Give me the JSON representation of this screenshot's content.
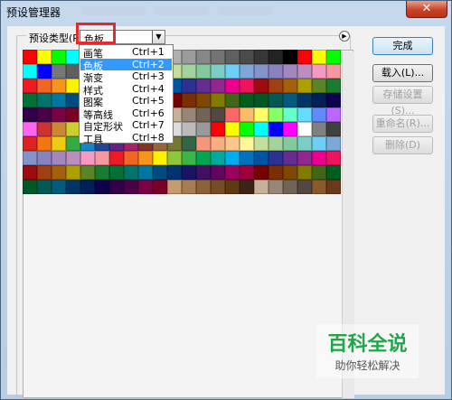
{
  "window": {
    "title": "预设管理器",
    "close_label": "✕"
  },
  "preset_type": {
    "label": "预设类型(P):",
    "value": "色板"
  },
  "menu_items": [
    {
      "label": "画笔",
      "shortcut": "Ctrl+1",
      "selected": false
    },
    {
      "label": "色板",
      "shortcut": "Ctrl+2",
      "selected": true
    },
    {
      "label": "渐变",
      "shortcut": "Ctrl+3",
      "selected": false
    },
    {
      "label": "样式",
      "shortcut": "Ctrl+4",
      "selected": false
    },
    {
      "label": "图案",
      "shortcut": "Ctrl+5",
      "selected": false
    },
    {
      "label": "等高线",
      "shortcut": "Ctrl+6",
      "selected": false
    },
    {
      "label": "自定形状",
      "shortcut": "Ctrl+7",
      "selected": false
    },
    {
      "label": "工具",
      "shortcut": "Ctrl+8",
      "selected": false
    }
  ],
  "buttons": {
    "done": "完成",
    "load": "载入(L)...",
    "save": "存储设置(S)...",
    "rename": "重命名(R)...",
    "delete": "删除(D)"
  },
  "swatches": [
    "#ff0000",
    "#ffff00",
    "#00ff00",
    "#00ffff",
    "#0000ff",
    "#ff00ff",
    "#ffffff",
    "#ebebeb",
    "#d7d7d7",
    "#c3c3c3",
    "#afafaf",
    "#9b9b9b",
    "#878787",
    "#737373",
    "#5f5f5f",
    "#4b4b4b",
    "#373737",
    "#232323",
    "#000000",
    "#ff0000",
    "#ffff00",
    "#00ff00",
    "#00ffff",
    "#0000ff",
    "#777777",
    "#5f5f5f",
    "#454545",
    "#2b2b2b",
    "#f7977a",
    "#f9ad81",
    "#fdc68a",
    "#fff79a",
    "#c4df9b",
    "#a3d39c",
    "#82ca9d",
    "#7bcdc8",
    "#6ecff6",
    "#7ea7d8",
    "#8493ca",
    "#8882be",
    "#a187be",
    "#bc8dbf",
    "#f49ac2",
    "#f6989d",
    "#ed1c24",
    "#f26522",
    "#f7941d",
    "#fff200",
    "#8dc63f",
    "#39b54a",
    "#00a651",
    "#00a99d",
    "#00aeef",
    "#0072bc",
    "#0054a6",
    "#2e3192",
    "#662d91",
    "#92278f",
    "#ec008c",
    "#ed145b",
    "#9e0b0f",
    "#a0410d",
    "#a36209",
    "#aba000",
    "#598527",
    "#1a7b30",
    "#007236",
    "#00746b",
    "#0076a3",
    "#004b80",
    "#003471",
    "#1b1464",
    "#440e62",
    "#630460",
    "#9e005d",
    "#9e0039",
    "#790000",
    "#7b2e00",
    "#7d4900",
    "#827b00",
    "#406618",
    "#005e20",
    "#005826",
    "#005952",
    "#005b7f",
    "#003663",
    "#002157",
    "#0d004c",
    "#32004b",
    "#4b0049",
    "#7b0046",
    "#7a0026",
    "#c69c6d",
    "#a67c52",
    "#8c6239",
    "#754c24",
    "#603913",
    "#3c2415",
    "#c7b299",
    "#998675",
    "#736357",
    "#534741",
    "#ff6666",
    "#ffbb66",
    "#ffff66",
    "#88ff66",
    "#66ffcc",
    "#66ddff",
    "#6688ff",
    "#bb66ff",
    "#ff66ee",
    "#cc3333",
    "#cc8833",
    "#cccc33",
    "#55aa33",
    "#33aa88",
    "#3399cc",
    "#3355cc",
    "#8833cc",
    "#cc33aa",
    "#dddddd",
    "#bbbbbb",
    "#999999",
    "#ff0000",
    "#ffff00",
    "#00ff00",
    "#00ffff",
    "#0000ff",
    "#ff00ff",
    "#ffffff",
    "#808080",
    "#404040",
    "#dd2222",
    "#ee7711",
    "#eecc11",
    "#33aa44",
    "#1188cc",
    "#224499",
    "#662288",
    "#aa2266",
    "#883322",
    "#996633",
    "#777733",
    "#336644",
    "#f7977a",
    "#f9ad81",
    "#fdc68a",
    "#fff79a",
    "#c4df9b",
    "#a3d39c",
    "#82ca9d",
    "#7bcdc8",
    "#6ecff6",
    "#7ea7d8",
    "#8493ca",
    "#8882be",
    "#a187be",
    "#bc8dbf",
    "#f49ac2",
    "#f6989d",
    "#ed1c24",
    "#f26522",
    "#f7941d",
    "#fff200",
    "#8dc63f",
    "#39b54a",
    "#00a651",
    "#00a99d",
    "#00aeef",
    "#0072bc",
    "#0054a6",
    "#2e3192",
    "#662d91",
    "#92278f",
    "#ec008c",
    "#ed145b",
    "#9e0b0f",
    "#a0410d",
    "#a36209",
    "#aba000",
    "#598527",
    "#1a7b30",
    "#007236",
    "#00746b",
    "#0076a3",
    "#004b80",
    "#003471",
    "#1b1464",
    "#440e62",
    "#630460",
    "#9e005d",
    "#9e0039",
    "#790000",
    "#7b2e00",
    "#7d4900",
    "#827b00",
    "#406618",
    "#005e20",
    "#005826",
    "#005952",
    "#005b7f",
    "#003663",
    "#002157",
    "#0d004c",
    "#32004b",
    "#4b0049",
    "#7b0046",
    "#7a0026",
    "#c69c6d",
    "#a67c52",
    "#8c6239",
    "#754c24",
    "#603913",
    "#3c2415",
    "#c7b299",
    "#998675",
    "#736357",
    "#534741",
    "#8a5a2b",
    "#6b3a1a"
  ],
  "watermark": {
    "title": "百科全说",
    "subtitle": "助你轻松解决"
  }
}
